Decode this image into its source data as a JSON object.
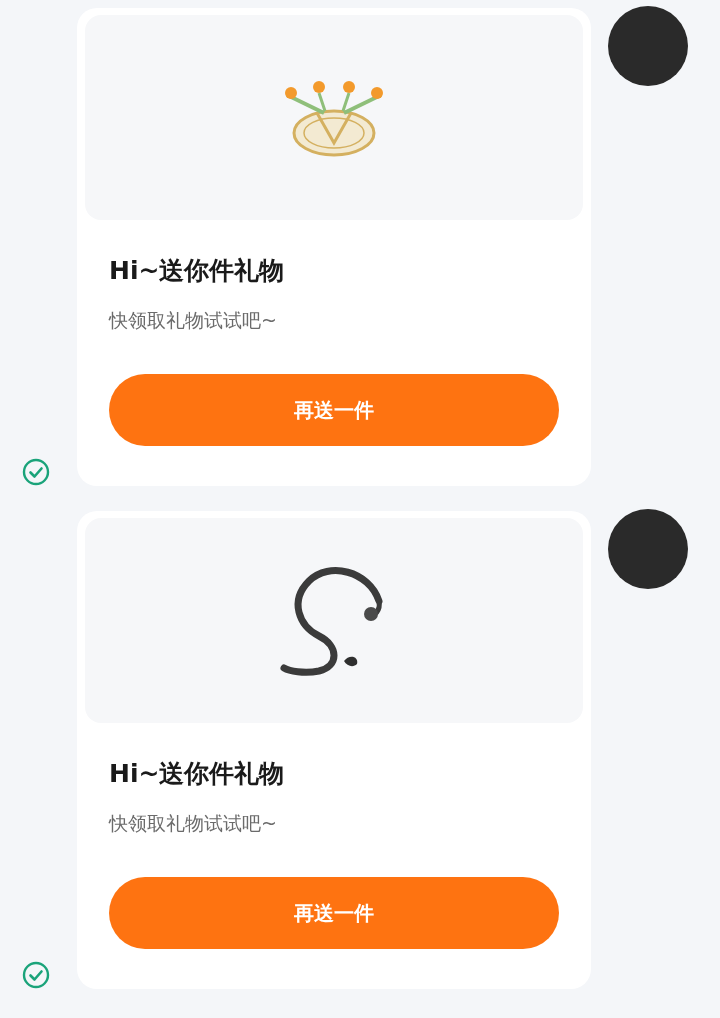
{
  "messages": [
    {
      "gift": {
        "kind": "emblem"
      },
      "title": "Hi~送你件礼物",
      "subtitle": "快领取礼物试试吧~",
      "button": "再送一件",
      "delivered": true
    },
    {
      "gift": {
        "kind": "dragon"
      },
      "title": "Hi~送你件礼物",
      "subtitle": "快领取礼物试试吧~",
      "button": "再送一件",
      "delivered": true
    }
  ]
}
